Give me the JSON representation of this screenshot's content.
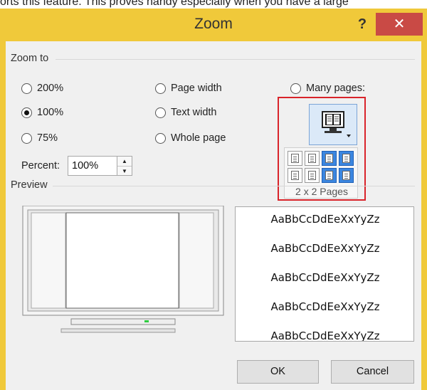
{
  "background_text": "orts this feature. This proves handy especially when you have a large",
  "dialog": {
    "title": "Zoom",
    "help_label": "?",
    "close_label": "✕",
    "title_bar_color": "#f0c93a",
    "close_color": "#c94a45"
  },
  "zoom_to": {
    "label": "Zoom to",
    "options": [
      {
        "label": "200%",
        "checked": false
      },
      {
        "label": "100%",
        "checked": true
      },
      {
        "label": "75%",
        "checked": false
      },
      {
        "label": "Page width",
        "checked": false
      },
      {
        "label": "Text width",
        "checked": false
      },
      {
        "label": "Whole page",
        "checked": false
      },
      {
        "label": "Many pages:",
        "checked": false
      }
    ]
  },
  "percent": {
    "label": "Percent:",
    "value": "100%",
    "up_icon": "▲",
    "down_icon": "▼"
  },
  "many_pages": {
    "grid_label": "2 x 2 Pages",
    "rows": 2,
    "cols": 4,
    "selected_rows": 2,
    "selected_cols": 2,
    "highlight_color": "#d9232a",
    "selection_color": "#3b86e0"
  },
  "preview": {
    "label": "Preview",
    "sample_lines": [
      "AaBbCcDdEeXxYyZz",
      "AaBbCcDdEeXxYyZz",
      "AaBbCcDdEeXxYyZz",
      "AaBbCcDdEeXxYyZz",
      "AaBbCcDdEeXxYyZz"
    ]
  },
  "buttons": {
    "ok": "OK",
    "cancel": "Cancel"
  }
}
